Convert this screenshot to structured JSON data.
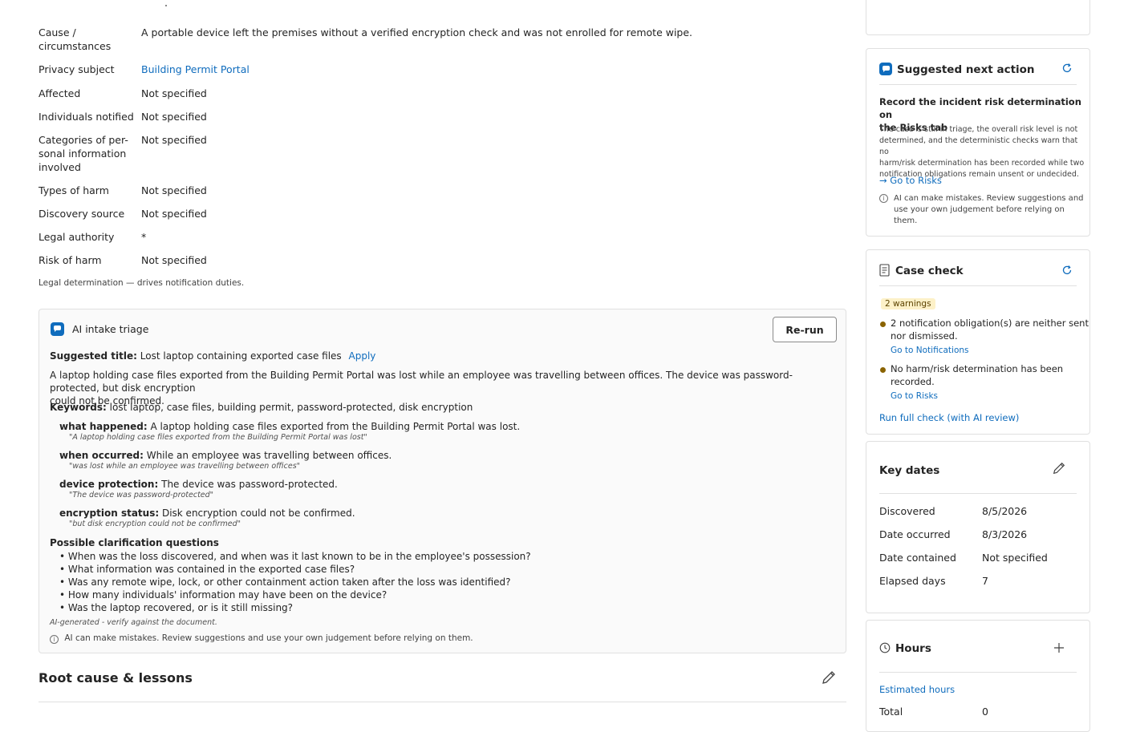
{
  "details": {
    "rows": [
      {
        "label": "Cause / circumstances",
        "value": "A portable device left the premises without a verified encryption check and was not enrolled for remote wipe.",
        "is_link": false
      },
      {
        "label": "Privacy subject",
        "value": "Building Permit Portal",
        "is_link": true
      },
      {
        "label": "Affected",
        "value": "Not specified",
        "is_link": false
      },
      {
        "label": "Individuals notified",
        "value": "Not specified",
        "is_link": false
      },
      {
        "label": "Categories of personal information involved",
        "value": "Not specified",
        "is_link": false
      },
      {
        "label": "Types of harm",
        "value": "Not specified",
        "is_link": false
      },
      {
        "label": "Discovery source",
        "value": "Not specified",
        "is_link": false
      },
      {
        "label": "Legal authority",
        "value": "*",
        "is_link": false
      },
      {
        "label": "Risk of harm",
        "value": "Not specified",
        "is_link": false
      }
    ],
    "cause_label_lines": [
      "Cause /",
      "circumstances"
    ],
    "categories_label_lines": [
      "Categories of per-",
      "sonal information",
      "involved"
    ],
    "risk_note": "Legal determination — drives notification duties."
  },
  "ai_triage": {
    "title": "AI intake triage",
    "rerun_label": "Re-run",
    "suggested_title_label": "Suggested title:",
    "suggested_title": "Lost laptop containing exported case files",
    "apply_label": "Apply",
    "summary_line1": "A laptop holding case files exported from the Building Permit Portal was lost while an employee was travelling between offices. The device was password-protected, but disk encryption",
    "summary_line2": "could not be confirmed.",
    "keywords_label": "Keywords:",
    "keywords": "lost laptop, case files, building permit, password-protected, disk encryption",
    "facts": [
      {
        "key": "what happened:",
        "text": "A laptop holding case files exported from the Building Permit Portal was lost.",
        "quote": "\"A laptop holding case files exported from the Building Permit Portal was lost\""
      },
      {
        "key": "when occurred:",
        "text": "While an employee was travelling between offices.",
        "quote": "\"was lost while an employee was travelling between offices\""
      },
      {
        "key": "device protection:",
        "text": "The device was password-protected.",
        "quote": "\"The device was password-protected\""
      },
      {
        "key": "encryption status:",
        "text": "Disk encryption could not be confirmed.",
        "quote": "\"but disk encryption could not be confirmed\""
      }
    ],
    "questions_heading": "Possible clarification questions",
    "questions": [
      "• When was the loss discovered, and when was it last known to be in the employee's possession?",
      "• What information was contained in the exported case files?",
      "• Was any remote wipe, lock, or other containment action taken after the loss was identified?",
      "• How many individuals' information may have been on the device?",
      "• Was the laptop recovered, or is it still missing?"
    ],
    "ai_generated_note": "AI-generated - verify against the document.",
    "disclaimer": "AI can make mistakes. Review suggestions and use your own judgement before relying on them."
  },
  "root_cause": {
    "title": "Root cause & lessons"
  },
  "next_action": {
    "title": "Suggested next action",
    "headline_line1": "Record the incident risk determination on",
    "headline_line2": "the Risks tab",
    "body_lines": [
      "The case is still in triage, the overall risk level is not",
      "determined, and the deterministic checks warn that no",
      "harm/risk determination has been recorded while two",
      "notification obligations remain unsent or undecided."
    ],
    "link": "Go to Risks",
    "disclaimer_lines": [
      "AI can make mistakes. Review suggestions and",
      "use your own judgement before relying on",
      "them."
    ]
  },
  "case_check": {
    "title": "Case check",
    "badge": "2 warnings",
    "warnings": [
      {
        "lines": [
          "2 notification obligation(s) are neither sent",
          "nor dismissed."
        ],
        "link": "Go to Notifications"
      },
      {
        "lines": [
          "No harm/risk determination has been",
          "recorded."
        ],
        "link": "Go to Risks"
      }
    ],
    "run_full": "Run full check (with AI review)"
  },
  "key_dates": {
    "title": "Key dates",
    "rows": [
      {
        "label": "Discovered",
        "value": "8/5/2026"
      },
      {
        "label": "Date occurred",
        "value": "8/3/2026"
      },
      {
        "label": "Date contained",
        "value": "Not specified"
      },
      {
        "label": "Elapsed days",
        "value": "7"
      }
    ]
  },
  "hours": {
    "title": "Hours",
    "estimated_link": "Estimated hours",
    "total_label": "Total",
    "total_value": "0"
  },
  "colors": {
    "accent": "#0f6cbd",
    "warning_bg": "#fdf1c8",
    "warning_dot": "#8a6300"
  }
}
